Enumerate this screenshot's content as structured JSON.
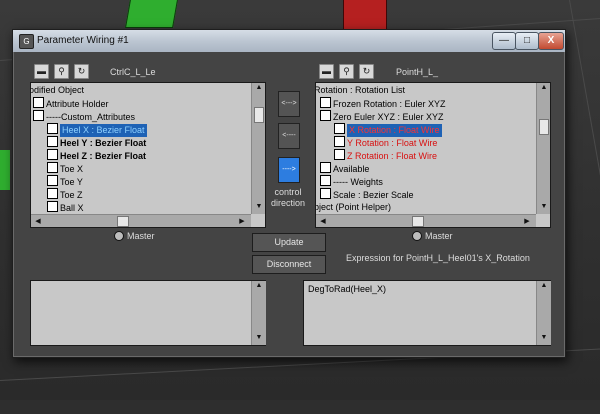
{
  "window": {
    "title": "Parameter Wiring #1",
    "icon": "3ds-max-icon",
    "minimize_glyph": "—",
    "maximize_glyph": "□",
    "close_glyph": "X"
  },
  "left_panel": {
    "track_label": "CtrlC_L_Le",
    "tree_items": [
      {
        "label": "odified Object",
        "style": "plain"
      },
      {
        "label": "Attribute Holder",
        "style": "plain"
      },
      {
        "label": "-----Custom_Attributes",
        "style": "plain"
      },
      {
        "label": "Heel X : Bezier Float",
        "style": "selected"
      },
      {
        "label": "Heel Y : Bezier Float",
        "style": "bold"
      },
      {
        "label": "Heel Z : Bezier Float",
        "style": "bold"
      },
      {
        "label": "Toe X",
        "style": "plain"
      },
      {
        "label": "Toe Y",
        "style": "plain"
      },
      {
        "label": "Toe Z",
        "style": "plain"
      },
      {
        "label": "Ball X",
        "style": "plain"
      }
    ],
    "master_label": "Master"
  },
  "right_panel": {
    "track_label": "PointH_L_",
    "tree_items": [
      {
        "label": "Rotation : Rotation List",
        "style": "plain"
      },
      {
        "label": "Frozen Rotation : Euler XYZ",
        "style": "plain"
      },
      {
        "label": "Zero Euler XYZ : Euler XYZ",
        "style": "plain"
      },
      {
        "label": "X Rotation : Float Wire",
        "style": "selected-red"
      },
      {
        "label": "Y Rotation : Float Wire",
        "style": "red"
      },
      {
        "label": "Z Rotation : Float Wire",
        "style": "red"
      },
      {
        "label": "Available",
        "style": "plain"
      },
      {
        "label": "----- Weights",
        "style": "plain"
      },
      {
        "label": "Scale : Bezier Scale",
        "style": "plain"
      },
      {
        "label": "bject (Point Helper)",
        "style": "plain"
      }
    ],
    "master_label": "Master"
  },
  "direction": {
    "both_label": "<--->",
    "left_label": "<----",
    "right_label": "---->",
    "control_label_line1": "control",
    "control_label_line2": "direction"
  },
  "buttons": {
    "update": "Update",
    "disconnect": "Disconnect"
  },
  "expression": {
    "label": "Expression for PointH_L_Heel01's X_Rotation",
    "left_text": "",
    "right_text": "DegToRad(Heel_X)"
  },
  "colors": {
    "selection_bg": "#1e62b5",
    "wire_red": "#d81010",
    "direction_active": "#2d7de0"
  }
}
